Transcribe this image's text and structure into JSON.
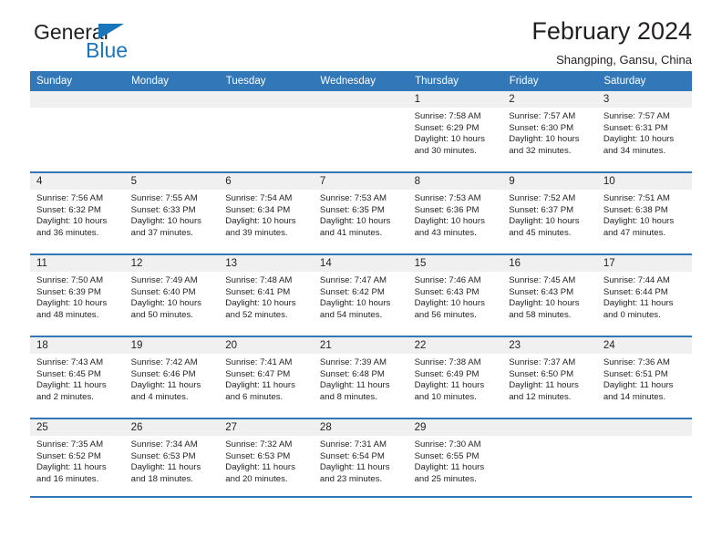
{
  "brand": {
    "name_dark": "General",
    "name_blue": "Blue",
    "accent_color": "#1b75bb"
  },
  "header": {
    "title": "February 2024",
    "subtitle": "Shangping, Gansu, China",
    "header_bg": "#3277b8",
    "daynum_bg": "#f0f0f0"
  },
  "weekday_headers": [
    "Sunday",
    "Monday",
    "Tuesday",
    "Wednesday",
    "Thursday",
    "Friday",
    "Saturday"
  ],
  "labels": {
    "sunrise_prefix": "Sunrise:",
    "sunset_prefix": "Sunset:",
    "daylight_prefix": "Daylight:"
  },
  "weeks": [
    [
      {
        "day": "",
        "blank": true
      },
      {
        "day": "",
        "blank": true
      },
      {
        "day": "",
        "blank": true
      },
      {
        "day": "",
        "blank": true
      },
      {
        "day": "1",
        "sunrise": "Sunrise: 7:58 AM",
        "sunset": "Sunset: 6:29 PM",
        "daylight": "Daylight: 10 hours and 30 minutes."
      },
      {
        "day": "2",
        "sunrise": "Sunrise: 7:57 AM",
        "sunset": "Sunset: 6:30 PM",
        "daylight": "Daylight: 10 hours and 32 minutes."
      },
      {
        "day": "3",
        "sunrise": "Sunrise: 7:57 AM",
        "sunset": "Sunset: 6:31 PM",
        "daylight": "Daylight: 10 hours and 34 minutes."
      }
    ],
    [
      {
        "day": "4",
        "sunrise": "Sunrise: 7:56 AM",
        "sunset": "Sunset: 6:32 PM",
        "daylight": "Daylight: 10 hours and 36 minutes."
      },
      {
        "day": "5",
        "sunrise": "Sunrise: 7:55 AM",
        "sunset": "Sunset: 6:33 PM",
        "daylight": "Daylight: 10 hours and 37 minutes."
      },
      {
        "day": "6",
        "sunrise": "Sunrise: 7:54 AM",
        "sunset": "Sunset: 6:34 PM",
        "daylight": "Daylight: 10 hours and 39 minutes."
      },
      {
        "day": "7",
        "sunrise": "Sunrise: 7:53 AM",
        "sunset": "Sunset: 6:35 PM",
        "daylight": "Daylight: 10 hours and 41 minutes."
      },
      {
        "day": "8",
        "sunrise": "Sunrise: 7:53 AM",
        "sunset": "Sunset: 6:36 PM",
        "daylight": "Daylight: 10 hours and 43 minutes."
      },
      {
        "day": "9",
        "sunrise": "Sunrise: 7:52 AM",
        "sunset": "Sunset: 6:37 PM",
        "daylight": "Daylight: 10 hours and 45 minutes."
      },
      {
        "day": "10",
        "sunrise": "Sunrise: 7:51 AM",
        "sunset": "Sunset: 6:38 PM",
        "daylight": "Daylight: 10 hours and 47 minutes."
      }
    ],
    [
      {
        "day": "11",
        "sunrise": "Sunrise: 7:50 AM",
        "sunset": "Sunset: 6:39 PM",
        "daylight": "Daylight: 10 hours and 48 minutes."
      },
      {
        "day": "12",
        "sunrise": "Sunrise: 7:49 AM",
        "sunset": "Sunset: 6:40 PM",
        "daylight": "Daylight: 10 hours and 50 minutes."
      },
      {
        "day": "13",
        "sunrise": "Sunrise: 7:48 AM",
        "sunset": "Sunset: 6:41 PM",
        "daylight": "Daylight: 10 hours and 52 minutes."
      },
      {
        "day": "14",
        "sunrise": "Sunrise: 7:47 AM",
        "sunset": "Sunset: 6:42 PM",
        "daylight": "Daylight: 10 hours and 54 minutes."
      },
      {
        "day": "15",
        "sunrise": "Sunrise: 7:46 AM",
        "sunset": "Sunset: 6:43 PM",
        "daylight": "Daylight: 10 hours and 56 minutes."
      },
      {
        "day": "16",
        "sunrise": "Sunrise: 7:45 AM",
        "sunset": "Sunset: 6:43 PM",
        "daylight": "Daylight: 10 hours and 58 minutes."
      },
      {
        "day": "17",
        "sunrise": "Sunrise: 7:44 AM",
        "sunset": "Sunset: 6:44 PM",
        "daylight": "Daylight: 11 hours and 0 minutes."
      }
    ],
    [
      {
        "day": "18",
        "sunrise": "Sunrise: 7:43 AM",
        "sunset": "Sunset: 6:45 PM",
        "daylight": "Daylight: 11 hours and 2 minutes."
      },
      {
        "day": "19",
        "sunrise": "Sunrise: 7:42 AM",
        "sunset": "Sunset: 6:46 PM",
        "daylight": "Daylight: 11 hours and 4 minutes."
      },
      {
        "day": "20",
        "sunrise": "Sunrise: 7:41 AM",
        "sunset": "Sunset: 6:47 PM",
        "daylight": "Daylight: 11 hours and 6 minutes."
      },
      {
        "day": "21",
        "sunrise": "Sunrise: 7:39 AM",
        "sunset": "Sunset: 6:48 PM",
        "daylight": "Daylight: 11 hours and 8 minutes."
      },
      {
        "day": "22",
        "sunrise": "Sunrise: 7:38 AM",
        "sunset": "Sunset: 6:49 PM",
        "daylight": "Daylight: 11 hours and 10 minutes."
      },
      {
        "day": "23",
        "sunrise": "Sunrise: 7:37 AM",
        "sunset": "Sunset: 6:50 PM",
        "daylight": "Daylight: 11 hours and 12 minutes."
      },
      {
        "day": "24",
        "sunrise": "Sunrise: 7:36 AM",
        "sunset": "Sunset: 6:51 PM",
        "daylight": "Daylight: 11 hours and 14 minutes."
      }
    ],
    [
      {
        "day": "25",
        "sunrise": "Sunrise: 7:35 AM",
        "sunset": "Sunset: 6:52 PM",
        "daylight": "Daylight: 11 hours and 16 minutes."
      },
      {
        "day": "26",
        "sunrise": "Sunrise: 7:34 AM",
        "sunset": "Sunset: 6:53 PM",
        "daylight": "Daylight: 11 hours and 18 minutes."
      },
      {
        "day": "27",
        "sunrise": "Sunrise: 7:32 AM",
        "sunset": "Sunset: 6:53 PM",
        "daylight": "Daylight: 11 hours and 20 minutes."
      },
      {
        "day": "28",
        "sunrise": "Sunrise: 7:31 AM",
        "sunset": "Sunset: 6:54 PM",
        "daylight": "Daylight: 11 hours and 23 minutes."
      },
      {
        "day": "29",
        "sunrise": "Sunrise: 7:30 AM",
        "sunset": "Sunset: 6:55 PM",
        "daylight": "Daylight: 11 hours and 25 minutes."
      },
      {
        "day": "",
        "blank": true
      },
      {
        "day": "",
        "blank": true
      }
    ]
  ]
}
